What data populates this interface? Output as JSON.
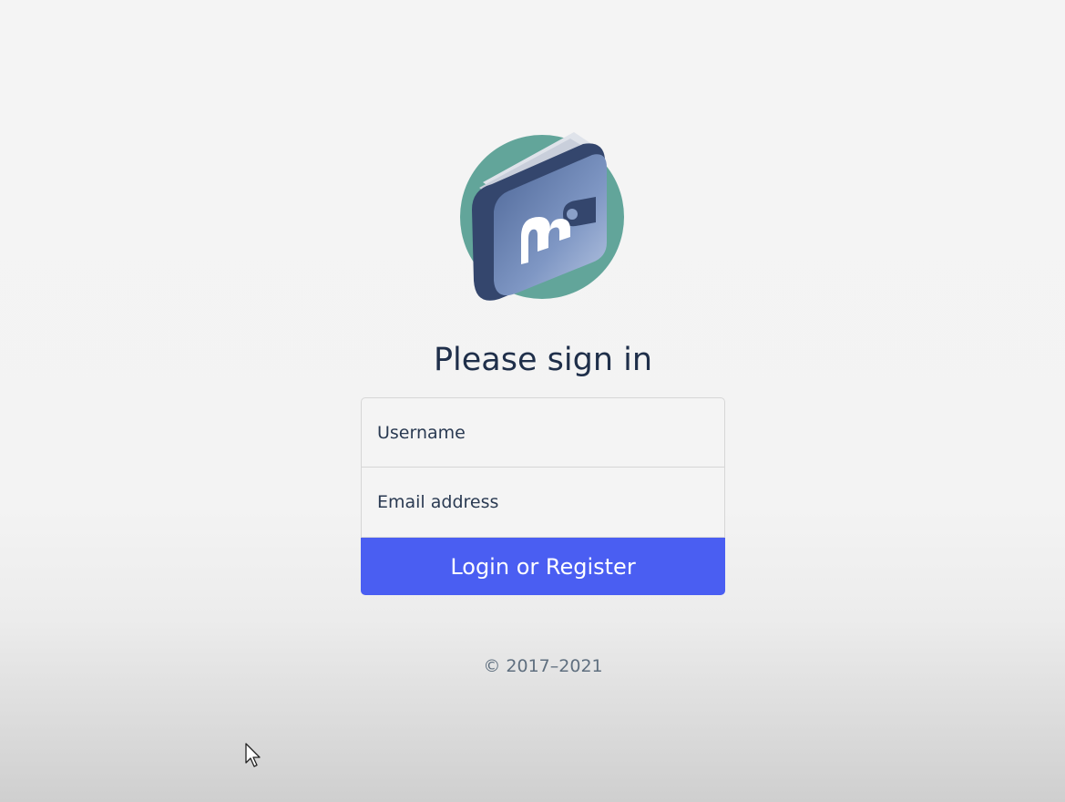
{
  "logo": {
    "icon": "wallet-logo-icon",
    "colors": {
      "circle": "#62a59a",
      "wallet_dark": "#34466d",
      "wallet_mid": "#5f78a8",
      "wallet_light": "#9fb3d6",
      "pages": "#dfe3ea",
      "letter": "#ffffff"
    }
  },
  "login": {
    "title": "Please sign in",
    "username_placeholder": "Username",
    "email_placeholder": "Email address",
    "submit_label": "Login or Register",
    "accent_color": "#4a5ef2"
  },
  "footer": {
    "copyright": "© 2017–2021"
  },
  "cursor": {
    "icon": "mouse-pointer-icon"
  }
}
